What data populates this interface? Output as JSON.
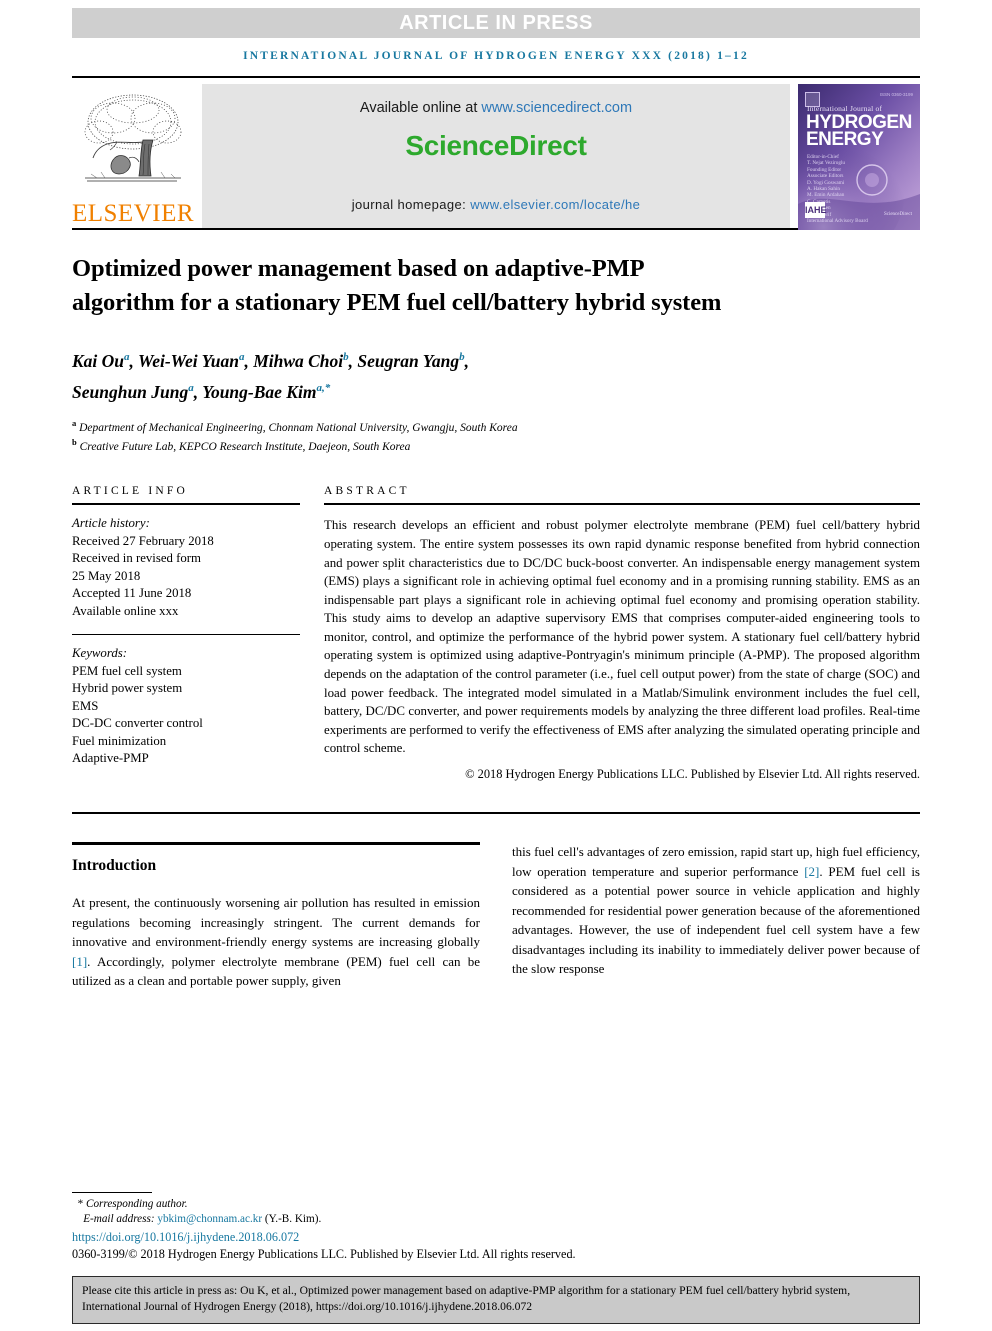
{
  "banner": {
    "article_in_press": "ARTICLE IN PRESS",
    "journal_running_head": "INTERNATIONAL JOURNAL OF HYDROGEN ENERGY XXX (2018) 1–12"
  },
  "masthead": {
    "available_online_label": "Available online at",
    "sciencedirect_url": "www.sciencedirect.com",
    "sciencedirect_logo": "ScienceDirect",
    "homepage_label": "journal homepage:",
    "homepage_url": "www.elsevier.com/locate/he",
    "publisher_name": "ELSEVIER",
    "cover": {
      "title_small": "International Journal of",
      "title_line1": "HYDROGEN",
      "title_line2": "ENERGY",
      "meta": "Editor-in-Chief\nT. Nejat Veziroglu\nFounding Editor\nAssociate Editors\nD. Yogi Goswami\nA. Hakan Sahin\nM. Emin Ardahan\nC. Carpetis\nP. Pedersen\nS. A. Sherif\nInternational Advisory Board",
      "badge_text": "IAHE",
      "footer": "ScienceDirect",
      "issn": "ISSN 0360-3199"
    }
  },
  "article": {
    "title": "Optimized power management based on adaptive-PMP algorithm for a stationary PEM fuel cell/battery hybrid system",
    "authors": [
      {
        "name": "Kai Ou",
        "sup": "a",
        "sep": ", "
      },
      {
        "name": "Wei-Wei Yuan",
        "sup": "a",
        "sep": ", "
      },
      {
        "name": "Mihwa Choi",
        "sup": "b",
        "sep": ", "
      },
      {
        "name": "Seugran Yang",
        "sup": "b",
        "sep": ", "
      },
      {
        "name": "Seunghun Jung",
        "sup": "a",
        "sep": ", "
      },
      {
        "name": "Young-Bae Kim",
        "sup": "a,*",
        "sep": ""
      }
    ],
    "affiliations": [
      {
        "marker": "a",
        "text": "Department of Mechanical Engineering, Chonnam National University, Gwangju, South Korea"
      },
      {
        "marker": "b",
        "text": "Creative Future Lab, KEPCO Research Institute, Daejeon, South Korea"
      }
    ]
  },
  "article_info": {
    "heading": "ARTICLE INFO",
    "history_label": "Article history:",
    "history": [
      "Received 27 February 2018",
      "Received in revised form",
      "25 May 2018",
      "Accepted 11 June 2018",
      "Available online xxx"
    ],
    "keywords_label": "Keywords:",
    "keywords": [
      "PEM fuel cell system",
      "Hybrid power system",
      "EMS",
      "DC-DC converter control",
      "Fuel minimization",
      "Adaptive-PMP"
    ]
  },
  "abstract": {
    "heading": "ABSTRACT",
    "text": "This research develops an efficient and robust polymer electrolyte membrane (PEM) fuel cell/battery hybrid operating system. The entire system possesses its own rapid dynamic response benefited from hybrid connection and power split characteristics due to DC/DC buck-boost converter. An indispensable energy management system (EMS) plays a significant role in achieving optimal fuel economy and in a promising running stability. EMS as an indispensable part plays a significant role in achieving optimal fuel economy and promising operation stability. This study aims to develop an adaptive supervisory EMS that comprises computer-aided engineering tools to monitor, control, and optimize the performance of the hybrid power system. A stationary fuel cell/battery hybrid operating system is optimized using adaptive-Pontryagin's minimum principle (A-PMP). The proposed algorithm depends on the adaptation of the control parameter (i.e., fuel cell output power) from the state of charge (SOC) and load power feedback. The integrated model simulated in a Matlab/Simulink environment includes the fuel cell, battery, DC/DC converter, and power requirements models by analyzing the three different load profiles. Real-time experiments are performed to verify the effectiveness of EMS after analyzing the simulated operating principle and control scheme.",
    "copyright": "© 2018 Hydrogen Energy Publications LLC. Published by Elsevier Ltd. All rights reserved."
  },
  "introduction": {
    "heading": "Introduction",
    "left_column_part1": "At present, the continuously worsening air pollution has resulted in emission regulations becoming increasingly stringent. The current demands for innovative and environment-friendly energy systems are increasing globally ",
    "left_ref": "[1]",
    "left_column_part2": ". Accordingly, polymer electrolyte membrane (PEM) fuel cell can be utilized as a clean and portable power supply, given",
    "right_column_part1": "this fuel cell's advantages of zero emission, rapid start up, high fuel efficiency, low operation temperature and superior performance ",
    "right_ref": "[2]",
    "right_column_part2": ". PEM fuel cell is considered as a potential power source in vehicle application and highly recommended for residential power generation because of the aforementioned advantages. However, the use of independent fuel cell system have a few disadvantages including its inability to immediately deliver power because of the slow response"
  },
  "footnotes": {
    "corresponding_marker": "*",
    "corresponding_label": "Corresponding author.",
    "email_label": "E-mail address:",
    "email": "ybkim@chonnam.ac.kr",
    "email_attribution": "(Y.-B. Kim).",
    "doi": "https://doi.org/10.1016/j.ijhydene.2018.06.072",
    "issn_line": "0360-3199/© 2018 Hydrogen Energy Publications LLC. Published by Elsevier Ltd. All rights reserved."
  },
  "cite_box": {
    "text": "Please cite this article in press as: Ou K, et al., Optimized power management based on adaptive-PMP algorithm for a stationary PEM fuel cell/battery hybrid system, International Journal of Hydrogen Energy (2018), https://doi.org/10.1016/j.ijhydene.2018.06.072"
  },
  "colors": {
    "accent_teal": "#1878a0",
    "sciencedirect_green": "#2da92d",
    "elsevier_orange": "#f08000",
    "banner_gray": "#cfcfcf",
    "cite_box_gray": "#c9c9c9",
    "link_blue": "#2e78b8"
  }
}
